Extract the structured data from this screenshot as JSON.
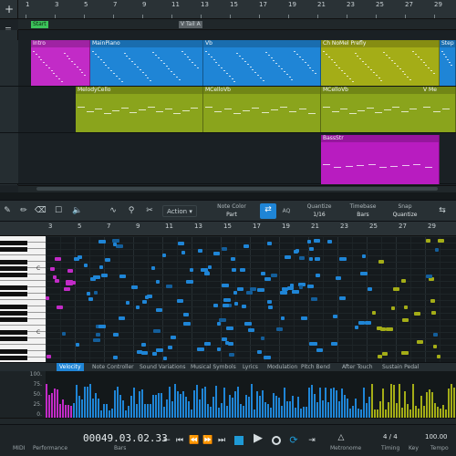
{
  "arrange": {
    "ruler_numbers": [
      "1",
      "3",
      "5",
      "7",
      "9",
      "11",
      "13",
      "15",
      "17",
      "19",
      "21",
      "23",
      "25",
      "27",
      "29"
    ],
    "markers": [
      {
        "label": "Start",
        "color": "#3cc25a"
      },
      {
        "label": "V Tail A",
        "color": "#5b6266"
      }
    ],
    "tracks": [
      {
        "parts": [
          {
            "label": "Intro",
            "color": "#c22bc7"
          },
          {
            "label": "MainPiano",
            "color": "#1f85d6"
          },
          {
            "label": "Vb",
            "color": "#1f85d6"
          },
          {
            "label": "Ch NoMel Prefly",
            "color": "#a4ad17"
          },
          {
            "label": "Step",
            "color": "#1f85d6"
          }
        ]
      },
      {
        "parts": [
          {
            "label": "MelodyCello",
            "color": "#8aa41c"
          },
          {
            "label": "MCelloVb",
            "color": "#8aa41c"
          },
          {
            "label": "MCelloVb",
            "color": "#8aa41c"
          },
          {
            "label": "V Me",
            "color": "#8aa41c"
          }
        ]
      },
      {
        "parts": [
          {
            "label": "BassStr",
            "color": "#b81cc0"
          }
        ]
      }
    ]
  },
  "toolbar": {
    "action_label": "Action",
    "note_color_label": "Note Color",
    "note_color_value": "Part",
    "aq_label": "AQ",
    "quantize_label": "Quantize",
    "quantize_value": "1/16",
    "timebase_label": "Timebase",
    "timebase_value": "Bars",
    "snap_label": "Snap",
    "snap_value": "Quantize"
  },
  "editor": {
    "ruler_numbers": [
      "3",
      "5",
      "7",
      "9",
      "11",
      "13",
      "15",
      "17",
      "19",
      "21",
      "23",
      "25",
      "27",
      "29"
    ],
    "key_labels": [
      "C",
      "C"
    ],
    "accent_color": "#1f85d6"
  },
  "controller": {
    "tabs": [
      "Velocity",
      "Note Controller",
      "Sound Variations",
      "Musical Symbols",
      "Lyrics",
      "Modulation",
      "Pitch Bend",
      "After Touch",
      "Sustain Pedal"
    ],
    "active_tab": "Velocity",
    "scale": [
      "100.",
      "75.",
      "50.",
      "25.",
      "0."
    ]
  },
  "transport": {
    "midi_label": "MIDI",
    "performance_label": "Performance",
    "position": "00049.03.02.33",
    "position_unit": "Bars",
    "signature": "4 / 4",
    "timing_label": "Timing",
    "metronome_label": "Metronome",
    "key_label": "Key",
    "tempo": "100.00",
    "tempo_label": "Tempo"
  }
}
